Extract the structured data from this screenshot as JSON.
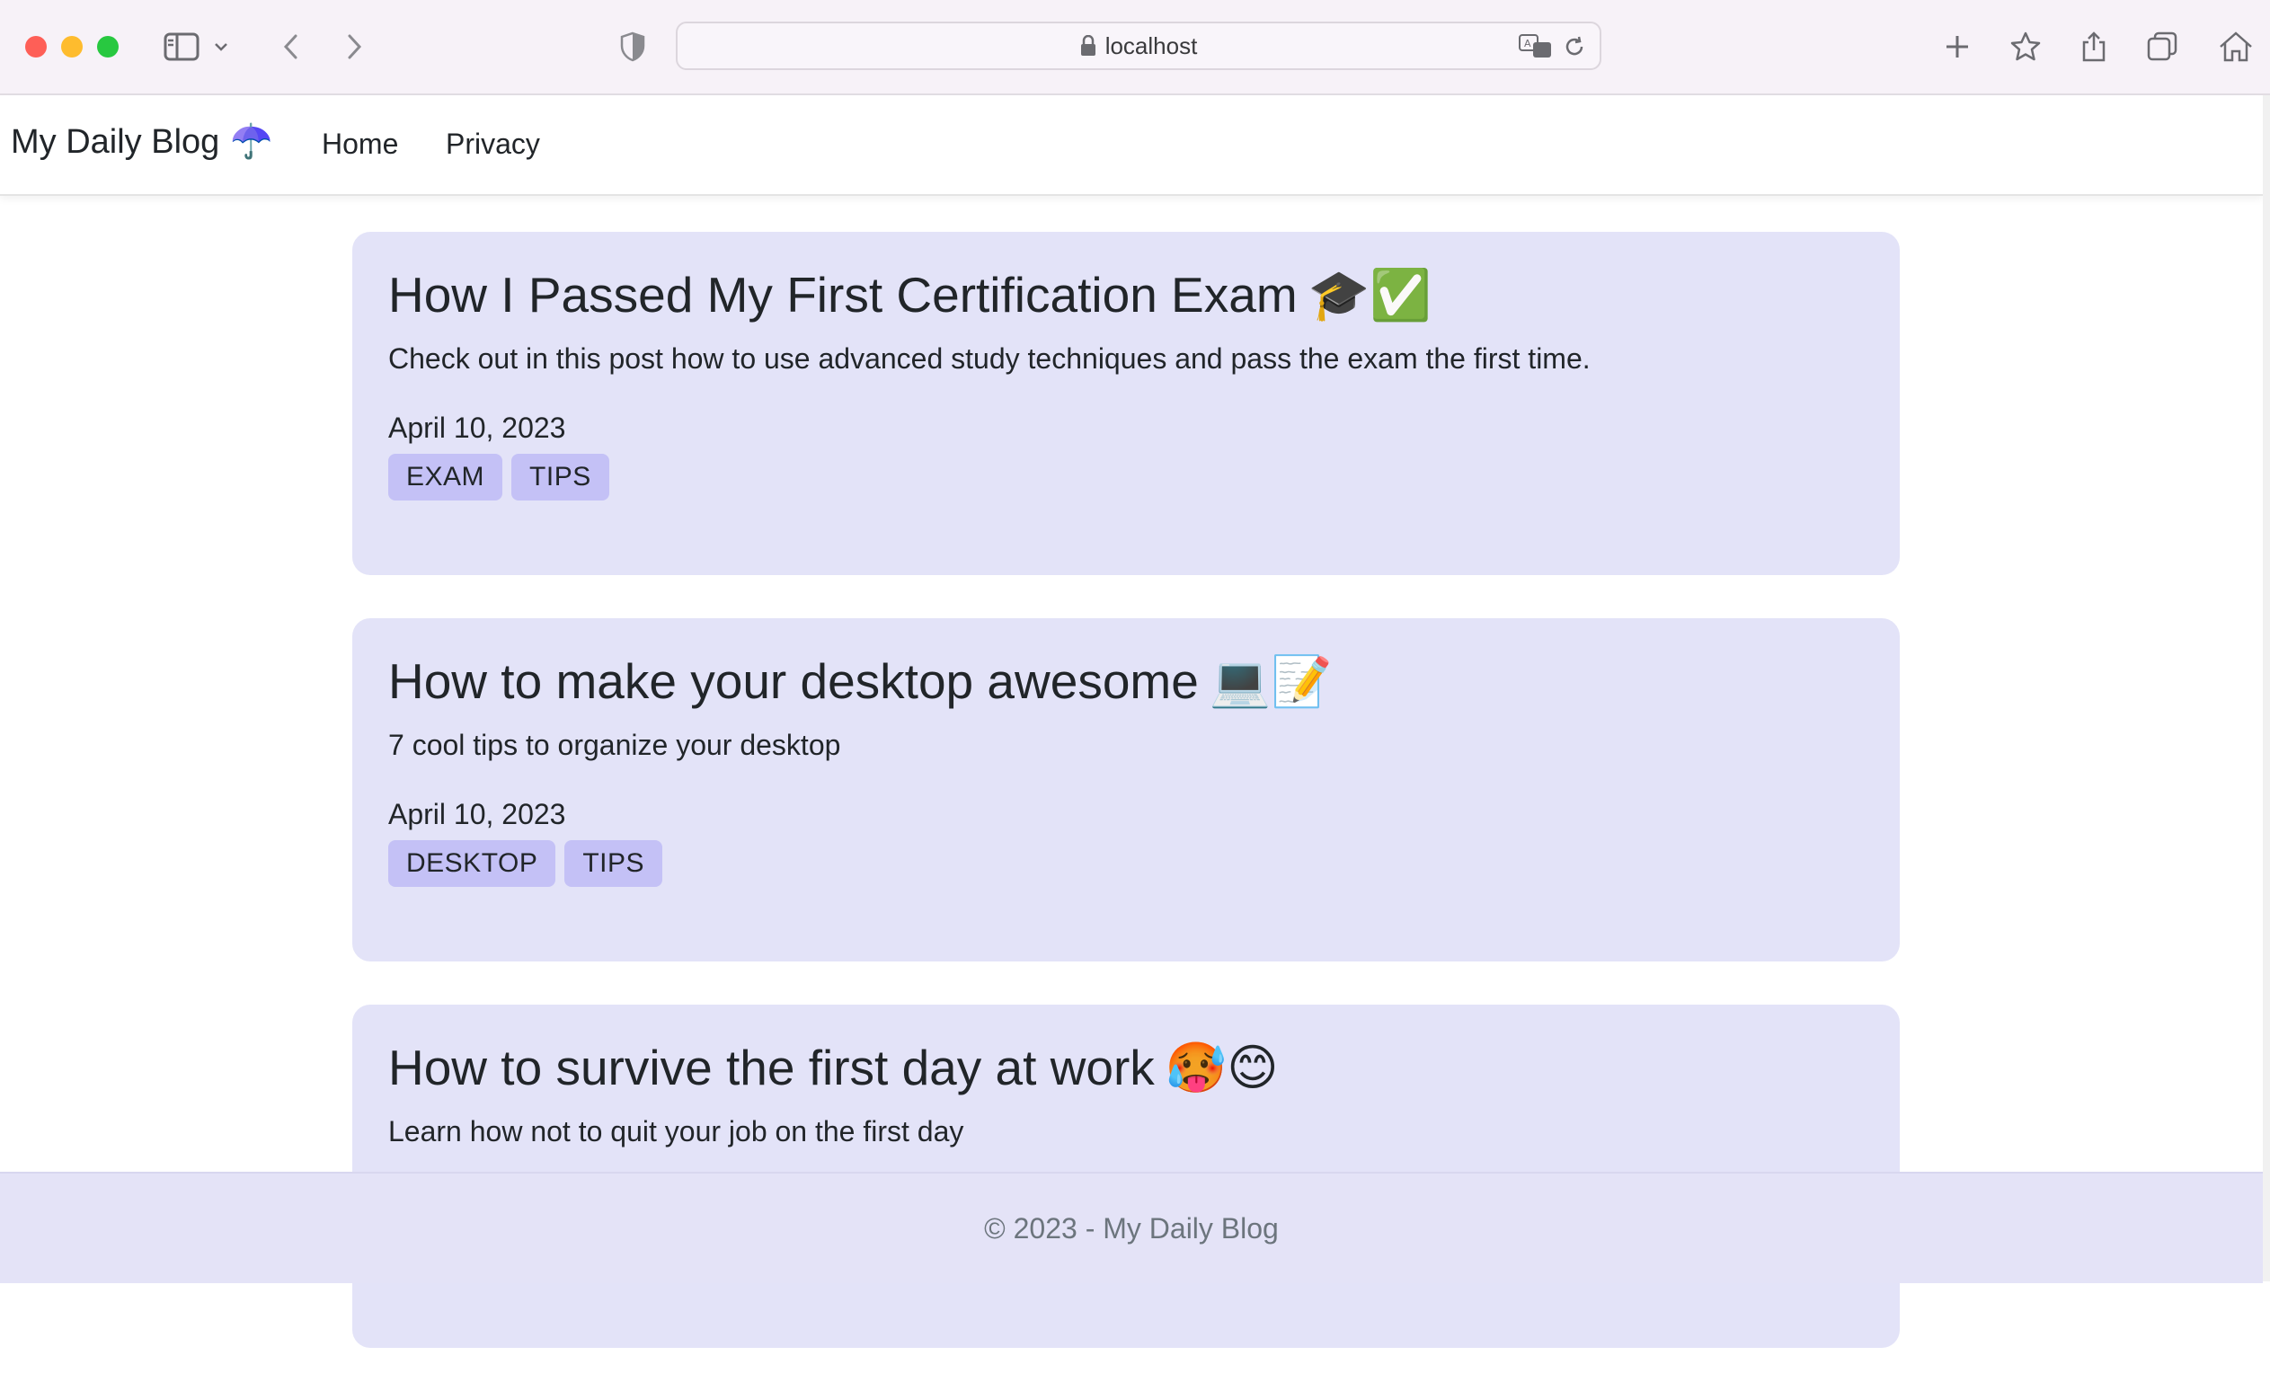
{
  "browser": {
    "url": "localhost",
    "icons": [
      "sidebar-icon",
      "chevron-down-icon",
      "back-icon",
      "forward-icon",
      "shield-icon",
      "lock-icon",
      "translate-icon",
      "reload-icon",
      "plus-icon",
      "star-icon",
      "share-icon",
      "tabs-icon",
      "home-icon"
    ]
  },
  "navbar": {
    "brand": "My Daily Blog",
    "brand_emoji": "☂️",
    "links": [
      "Home",
      "Privacy"
    ]
  },
  "posts": [
    {
      "title": "How I Passed My First Certification Exam",
      "emojis": "🎓✅",
      "description": "Check out in this post how to use advanced study techniques and pass the exam the first time.",
      "date": "April 10, 2023",
      "tags": [
        "EXAM",
        "TIPS"
      ]
    },
    {
      "title": "How to make your desktop awesome",
      "emojis": "💻📝",
      "description": "7 cool tips to organize your desktop",
      "date": "April 10, 2023",
      "tags": [
        "DESKTOP",
        "TIPS"
      ]
    },
    {
      "title": "How to survive the first day at work",
      "emojis": "🥵😊",
      "description": "Learn how not to quit your job on the first day",
      "date": "",
      "tags": []
    }
  ],
  "footer": {
    "text": "© 2023 - My Daily Blog"
  },
  "colors": {
    "card": "#e3e3f8",
    "tag": "#c4c1f6",
    "footer": "#e4e3f7",
    "chrome": "#f7f2f8"
  }
}
